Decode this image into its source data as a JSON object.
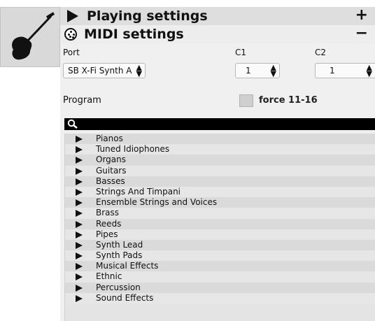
{
  "icon": "guitar-icon",
  "playing_settings": {
    "title": "Playing settings",
    "toggle": "+",
    "icon": "chevron-right-icon"
  },
  "midi_settings": {
    "title": "MIDI settings",
    "toggle": "−",
    "icon": "midi-connector-icon"
  },
  "labels": {
    "port": "Port",
    "c1": "C1",
    "c2": "C2",
    "program": "Program",
    "force": "force 11-16"
  },
  "port_select": {
    "value": "SB X-Fi Synth A [CO"
  },
  "c1_select": {
    "value": "1"
  },
  "c2_select": {
    "value": "1"
  },
  "search": {
    "icon": "search-icon"
  },
  "instrument_tree": [
    "Pianos",
    "Tuned Idiophones",
    "Organs",
    "Guitars",
    "Basses",
    "Strings And Timpani",
    "Ensemble Strings and Voices",
    "Brass",
    "Reeds",
    "Pipes",
    "Synth Lead",
    "Synth Pads",
    "Musical Effects",
    "Ethnic",
    "Percussion",
    "Sound Effects"
  ]
}
